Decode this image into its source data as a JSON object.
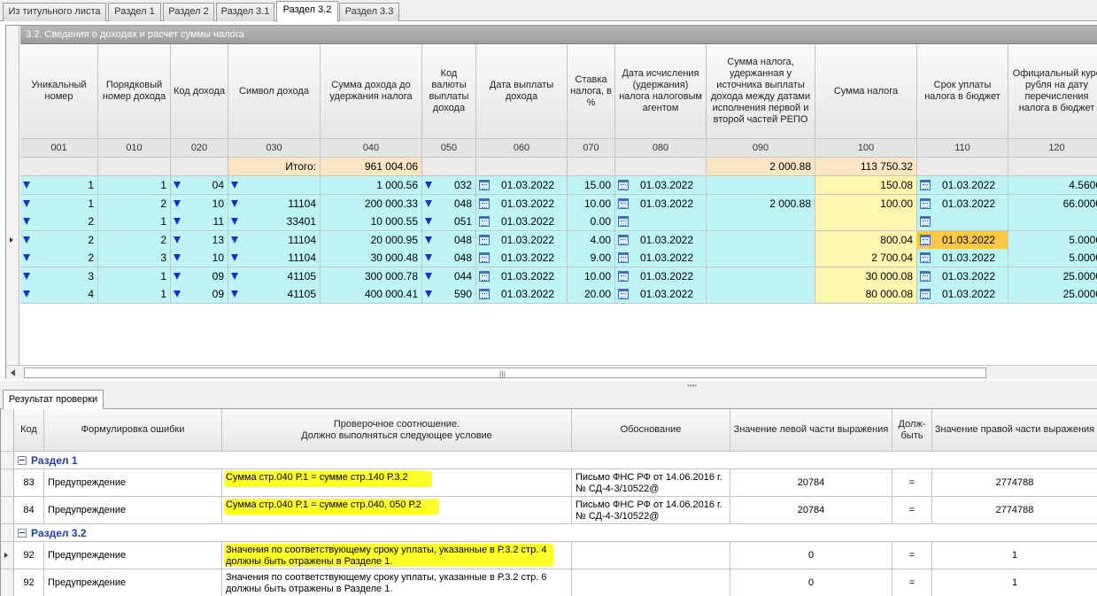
{
  "tabs": [
    "Из титульного листа",
    "Раздел 1",
    "Раздел 2",
    "Раздел 3.1",
    "Раздел 3.2",
    "Раздел 3.3"
  ],
  "active_tab": 4,
  "section_title": "3.2. Сведения о доходах и расчет суммы налога",
  "columns": [
    {
      "header": "Уникальный номер",
      "code": "001"
    },
    {
      "header": "Порядковый номер дохода",
      "code": "010"
    },
    {
      "header": "Код дохода",
      "code": "020"
    },
    {
      "header": "Символ дохода",
      "code": "030"
    },
    {
      "header": "Сумма дохода до удержания налога",
      "code": "040"
    },
    {
      "header": "Код валюты выплаты дохода",
      "code": "050"
    },
    {
      "header": "Дата выплаты дохода",
      "code": "060"
    },
    {
      "header": "Ставка налога, в %",
      "code": "070"
    },
    {
      "header": "Дата исчисления (удержания) налога налоговым агентом",
      "code": "080"
    },
    {
      "header": "Сумма налога, удержанная у источника выплаты дохода между датами исполнения первой и второй частей РЕПО",
      "code": "090"
    },
    {
      "header": "Сумма налога",
      "code": "100"
    },
    {
      "header": "Срок уплаты налога в бюджет",
      "code": "110"
    },
    {
      "header": "Официальный курс рубля на дату перечисления налога в бюджет",
      "code": "120"
    }
  ],
  "totals": {
    "label": "Итого:",
    "c040": "961 004.06",
    "c090": "2 000.88",
    "c100": "113 750.32"
  },
  "rows": [
    {
      "c001": "1",
      "c010": "1",
      "c020": "04",
      "c030": "",
      "c040": "1 000.56",
      "c050": "032",
      "c060": "01.03.2022",
      "c070": "15.00",
      "c080": "01.03.2022",
      "c090": "",
      "c100": "150.08",
      "c110": "01.03.2022",
      "c120": "4.5600"
    },
    {
      "c001": "1",
      "c010": "2",
      "c020": "10",
      "c030": "11104",
      "c040": "200 000.33",
      "c050": "048",
      "c060": "01.03.2022",
      "c070": "10.00",
      "c080": "01.03.2022",
      "c090": "2 000.88",
      "c100": "100.00",
      "c110": "01.03.2022",
      "c120": "66.0000"
    },
    {
      "c001": "2",
      "c010": "1",
      "c020": "11",
      "c030": "33401",
      "c040": "10 000.55",
      "c050": "051",
      "c060": "01.03.2022",
      "c070": "0.00",
      "c080": "",
      "c090": "",
      "c100": "",
      "c110": "",
      "c120": ""
    },
    {
      "c001": "2",
      "c010": "2",
      "c020": "13",
      "c030": "11104",
      "c040": "20 000.95",
      "c050": "048",
      "c060": "01.03.2022",
      "c070": "4.00",
      "c080": "01.03.2022",
      "c090": "",
      "c100": "800.04",
      "c110": "01.03.2022",
      "c120": "5.0000"
    },
    {
      "c001": "2",
      "c010": "3",
      "c020": "10",
      "c030": "11104",
      "c040": "30 000.48",
      "c050": "048",
      "c060": "01.03.2022",
      "c070": "9.00",
      "c080": "01.03.2022",
      "c090": "",
      "c100": "2 700.04",
      "c110": "01.03.2022",
      "c120": "5.0000"
    },
    {
      "c001": "3",
      "c010": "1",
      "c020": "09",
      "c030": "41105",
      "c040": "300 000.78",
      "c050": "044",
      "c060": "01.03.2022",
      "c070": "10.00",
      "c080": "01.03.2022",
      "c090": "",
      "c100": "30 000.08",
      "c110": "01.03.2022",
      "c120": "25.0000"
    },
    {
      "c001": "4",
      "c010": "1",
      "c020": "09",
      "c030": "41105",
      "c040": "400 000.41",
      "c050": "590",
      "c060": "01.03.2022",
      "c070": "20.00",
      "c080": "01.03.2022",
      "c090": "",
      "c100": "80 000.08",
      "c110": "01.03.2022",
      "c120": "25.0000"
    }
  ],
  "selected_row": 3,
  "check_tab": "Результат проверки",
  "check_columns": [
    "Код",
    "Формулировка ошибки",
    "Проверочное соотношение.\nДолжно выполняться следующее условие",
    "Обоснование",
    "Значение левой части выражения",
    "Долж-быть",
    "Значение правой части выражения"
  ],
  "check_groups": [
    {
      "title": "Раздел 1",
      "items": [
        {
          "code": "83",
          "type": "Предупреждение",
          "condition": "Сумма стр.040 Р.1 = сумме стр.140 Р.3.2",
          "basis": "Письмо ФНС РФ от 14.06.2016 г. № СД-4-3/10522@",
          "left": "20784",
          "op": "=",
          "right": "2774788"
        },
        {
          "code": "84",
          "type": "Предупреждение",
          "condition": "Сумма стр.040 Р.1 = сумме стр.040, 050 Р.2",
          "basis": "Письмо ФНС РФ от 14.06.2016 г. № СД-4-3/10522@",
          "left": "20784",
          "op": "=",
          "right": "2774788"
        }
      ]
    },
    {
      "title": "Раздел 3.2",
      "items": [
        {
          "code": "92",
          "type": "Предупреждение",
          "condition": "Значения по соответствующему сроку уплаты, указанные в Р.3.2 стр. 4 должны быть отражены в Разделе 1.",
          "basis": "",
          "left": "0",
          "op": "=",
          "right": "1"
        },
        {
          "code": "92",
          "type": "Предупреждение",
          "condition": "Значения по соответствующему сроку уплаты, указанные в Р.3.2 стр. 6 должны быть отражены в Разделе 1.",
          "basis": "",
          "left": "0",
          "op": "=",
          "right": "1"
        }
      ]
    }
  ],
  "colors": {
    "data_row": "#bdf5f5",
    "tax_column": "#fff7b0",
    "total_tan": "#f8e6c4",
    "selected_cell": "#ffc844",
    "highlight": "#ffff2a",
    "group_text": "#1f3fa8",
    "dropdown_icon": "#1a2ecc"
  }
}
